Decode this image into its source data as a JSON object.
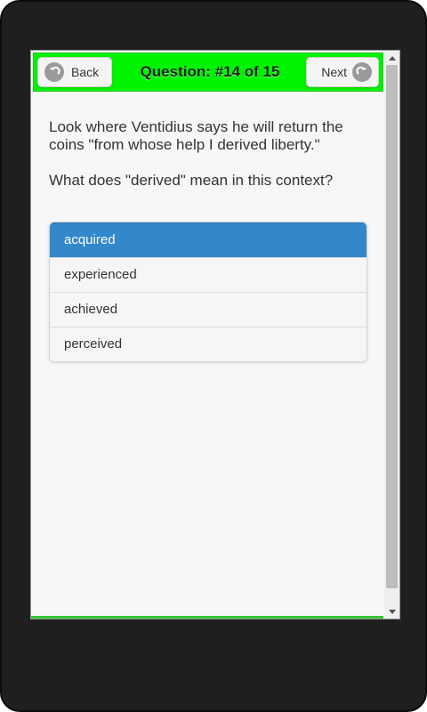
{
  "header": {
    "back_label": "Back",
    "title": "Question: #14 of 15",
    "next_label": "Next"
  },
  "question": {
    "text": "Look where Ventidius says he will return the coins \"from whose help I derived liberty.\"",
    "prompt": "What does \"derived\" mean in this context?"
  },
  "choices": [
    {
      "label": "acquired",
      "selected": true
    },
    {
      "label": "experienced",
      "selected": false
    },
    {
      "label": "achieved",
      "selected": false
    },
    {
      "label": "perceived",
      "selected": false
    }
  ],
  "colors": {
    "header_bg": "#00f400",
    "selected_choice": "#3388cc",
    "device_frame": "#1f1f1f",
    "page_bg": "#f7f7f7"
  },
  "icons": {
    "back": "back-arrow-icon",
    "next": "forward-arrow-icon"
  }
}
